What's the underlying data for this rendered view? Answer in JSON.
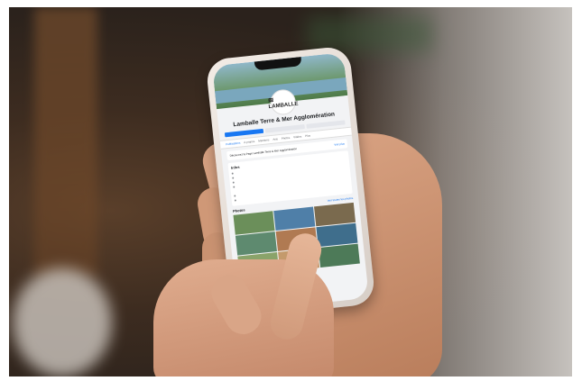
{
  "scene": {
    "background_color": "#2b221c",
    "phone_case_color": "#e6ddd6"
  },
  "facebook_page": {
    "accent_color": "#1877f2",
    "logo_text": "LAMBALLE",
    "page_name": "Lamballe Terre & Mer Agglomération",
    "page_subtitle": "",
    "tabs": [
      "Publications",
      "À propos",
      "Mentions",
      "Avis",
      "Photos",
      "Vidéos",
      "Plus"
    ],
    "post_prompt": "Découvrez la Page Lamballe Terre & Mer Agglomération",
    "post_link": "Voir plus",
    "info_title": "Infos",
    "photos_title": "Photos",
    "photos_link": "Voir toutes les photos",
    "photo_colors": [
      "#6b8f5a",
      "#4f7fa8",
      "#7a6a4e",
      "#5e8a6f",
      "#b07a52",
      "#3f6e8c",
      "#8aa36a",
      "#c49a6c",
      "#4d7a58"
    ]
  }
}
